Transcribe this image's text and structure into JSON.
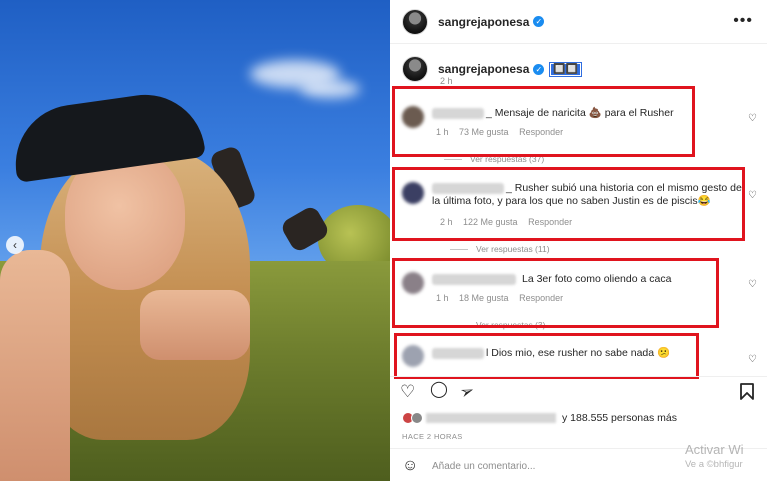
{
  "post": {
    "username": "sangrejaponesa",
    "more_icon": "more-horizontal-icon",
    "caption_emoji": "🔲🔲",
    "caption_time": "2 h",
    "verified_color": "#1a8cf0"
  },
  "comments": [
    {
      "text": "_ Mensaje de naricita 💩 para el Rusher",
      "time": "1 h",
      "likes": "73 Me gusta",
      "reply": "Responder",
      "replies": "Ver respuestas (37)"
    },
    {
      "text": "_ Rusher subió una historia con el mismo gesto de la última foto, y para los que no saben Justin es de piscis😂",
      "time": "2 h",
      "likes": "122 Me gusta",
      "reply": "Responder",
      "replies": "Ver respuestas (11)"
    },
    {
      "text": "La 3er foto como oliendo a caca",
      "time": "1 h",
      "likes": "18 Me gusta",
      "reply": "Responder",
      "replies": "Ver respuestas (3)"
    },
    {
      "text": "l Dios mio, ese rusher no sabe nada 😕",
      "time": "",
      "likes": "",
      "reply": "",
      "replies": ""
    }
  ],
  "likes_text": "y 188.555 personas más",
  "time_ago": "HACE 2 HORAS",
  "add_comment_placeholder": "Añade un comentario...",
  "watermark": {
    "line1": "Activar Wi",
    "line2": "Ve a ©bhfigur"
  },
  "highlight_color": "#e0141e"
}
